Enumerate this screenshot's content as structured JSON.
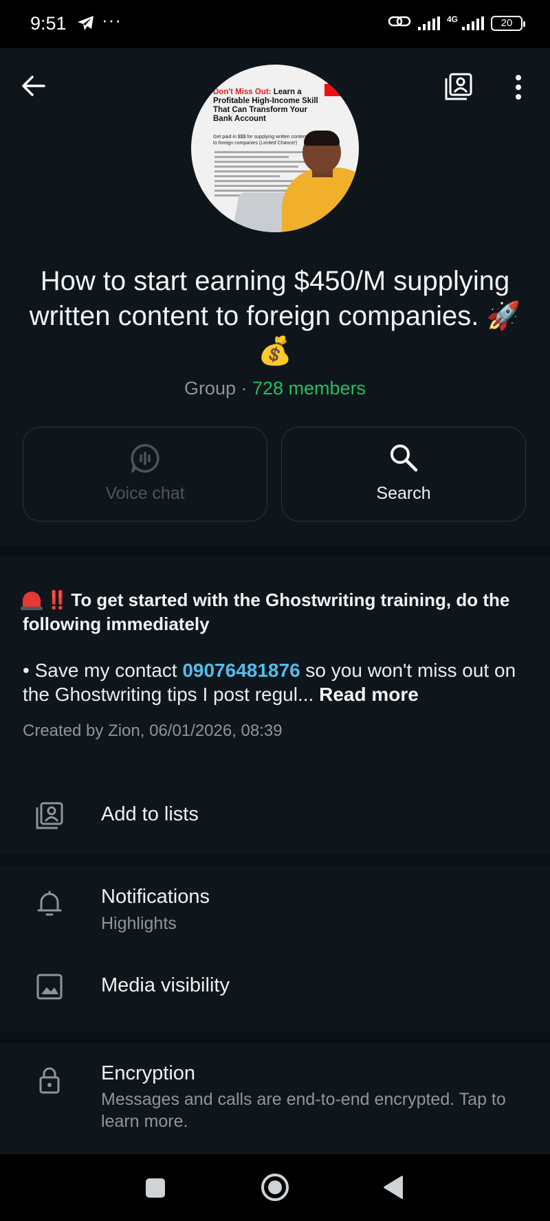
{
  "status_bar": {
    "time": "9:51",
    "overflow_indicator": "···",
    "network_type": "4G",
    "battery_level": "20",
    "icons": [
      "telegram-icon",
      "link-icon",
      "signal-icon",
      "battery-icon"
    ]
  },
  "header": {
    "icons": [
      "back-arrow-icon",
      "add-to-list-icon",
      "more-vert-icon"
    ],
    "avatar_text": {
      "headline_red": "Don't Miss Out:",
      "headline_rest": "Learn a Profitable High-Income Skill That Can Transform Your Bank Account",
      "subline": "Get paid in $$$ for supplying written content to foreign companies (Limited Chance!)"
    },
    "title": "How to start earning $450/M supplying written content to foreign companies. 🚀 💰",
    "meta_prefix": "Group · ",
    "members": "728 members"
  },
  "actions": {
    "voice_chat": {
      "label": "Voice chat",
      "icon": "voice-chat-icon",
      "enabled": false
    },
    "search": {
      "label": "Search",
      "icon": "search-icon",
      "enabled": true
    }
  },
  "description": {
    "headline_emoji": "‼️",
    "headline": "To get started with the Ghostwriting training, do the following immediately",
    "body_prefix": "• Save my contact ",
    "phone": "09076481876",
    "body_suffix": " so you won't miss out on the Ghostwriting tips I post regul... ",
    "read_more": "Read more",
    "created": "Created by Zion, 06/01/2026, 08:39"
  },
  "rows": {
    "add_to_lists": {
      "title": "Add to lists",
      "icon": "add-to-list-icon"
    },
    "notifications": {
      "title": "Notifications",
      "subtitle": "Highlights",
      "icon": "bell-icon"
    },
    "media_visibility": {
      "title": "Media visibility",
      "icon": "image-icon"
    },
    "encryption": {
      "title": "Encryption",
      "subtitle": "Messages and calls are end-to-end encrypted. Tap to learn more.",
      "icon": "lock-icon"
    }
  },
  "colors": {
    "background": "#0b1014",
    "surface": "#0f161b",
    "accent_green": "#21c063",
    "link_blue": "#53bdeb",
    "muted_text": "#8d959b"
  },
  "nav_bar": {
    "icons": [
      "recents-square-icon",
      "home-circle-icon",
      "back-triangle-icon"
    ]
  }
}
